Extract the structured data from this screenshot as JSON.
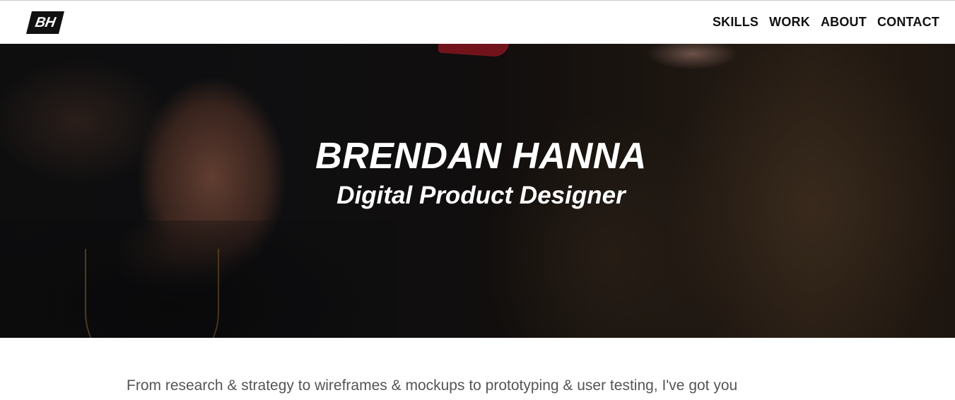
{
  "header": {
    "logo_text": "BH",
    "nav": [
      {
        "label": "SKILLS"
      },
      {
        "label": "WORK"
      },
      {
        "label": "ABOUT"
      },
      {
        "label": "CONTACT"
      }
    ]
  },
  "hero": {
    "title": "BRENDAN HANNA",
    "subtitle": "Digital Product Designer"
  },
  "intro": {
    "text": "From research & strategy to wireframes & mockups to prototyping & user testing, I've got you"
  },
  "colors": {
    "text_dark": "#111111",
    "body_text": "#555555",
    "hero_text": "#ffffff",
    "logo_bg": "#111111"
  }
}
